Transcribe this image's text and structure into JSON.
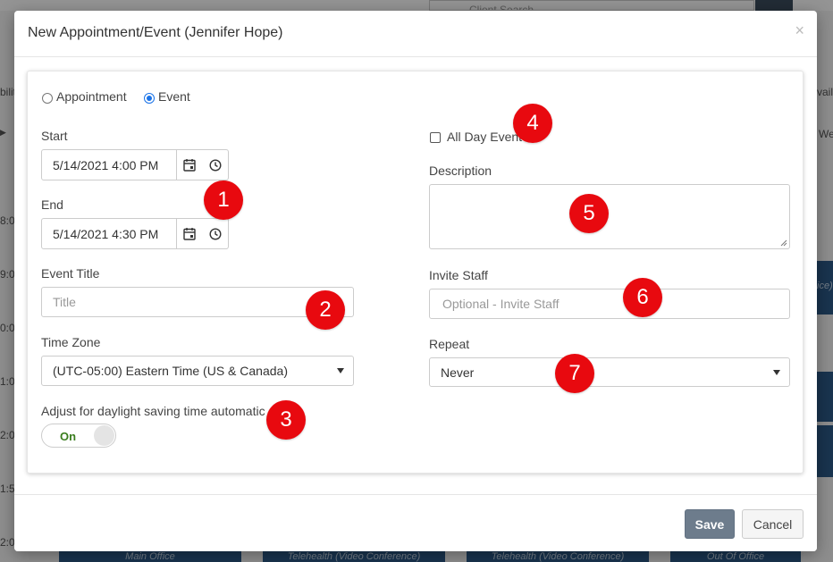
{
  "background": {
    "search_placeholder": "Client Search",
    "hours": [
      "8:0",
      "9:0",
      "0:0",
      "1:0",
      "2:0",
      "1:5",
      "2:0"
    ],
    "events": [
      "Main Office",
      "Telehealth (Video Conference)",
      "Telehealth (Video Conference)",
      "Out Of Office"
    ],
    "edge_left": "bilit",
    "edge_right_top": "vail",
    "edge_right_we": "We",
    "edge_right_ice": "ice)"
  },
  "modal": {
    "title": "New Appointment/Event (Jennifer Hope)",
    "close_symbol": "×",
    "type_options": [
      {
        "label": "Appointment",
        "selected": false
      },
      {
        "label": "Event",
        "selected": true
      }
    ],
    "start": {
      "label": "Start",
      "value": "5/14/2021 4:00 PM"
    },
    "end": {
      "label": "End",
      "value": "5/14/2021 4:30 PM"
    },
    "event_title": {
      "label": "Event Title",
      "placeholder": "Title"
    },
    "time_zone": {
      "label": "Time Zone",
      "value": "(UTC-05:00) Eastern Time (US & Canada)"
    },
    "dst": {
      "label": "Adjust for daylight saving time automatic",
      "toggle_label": "On",
      "on": true
    },
    "all_day": {
      "label": "All Day Event",
      "checked": false
    },
    "description": {
      "label": "Description",
      "value": ""
    },
    "invite_staff": {
      "label": "Invite Staff",
      "placeholder": "Optional - Invite Staff"
    },
    "repeat": {
      "label": "Repeat",
      "value": "Never"
    },
    "save_label": "Save",
    "cancel_label": "Cancel"
  },
  "annotations": [
    "1",
    "2",
    "3",
    "4",
    "5",
    "6",
    "7"
  ],
  "colors": {
    "badge": "#e8090f",
    "save_button": "#6d7c8c",
    "toggle_on_text": "#3a7d1e",
    "radio_checked": "#1a73e8",
    "background_event": "#2b5a89"
  }
}
